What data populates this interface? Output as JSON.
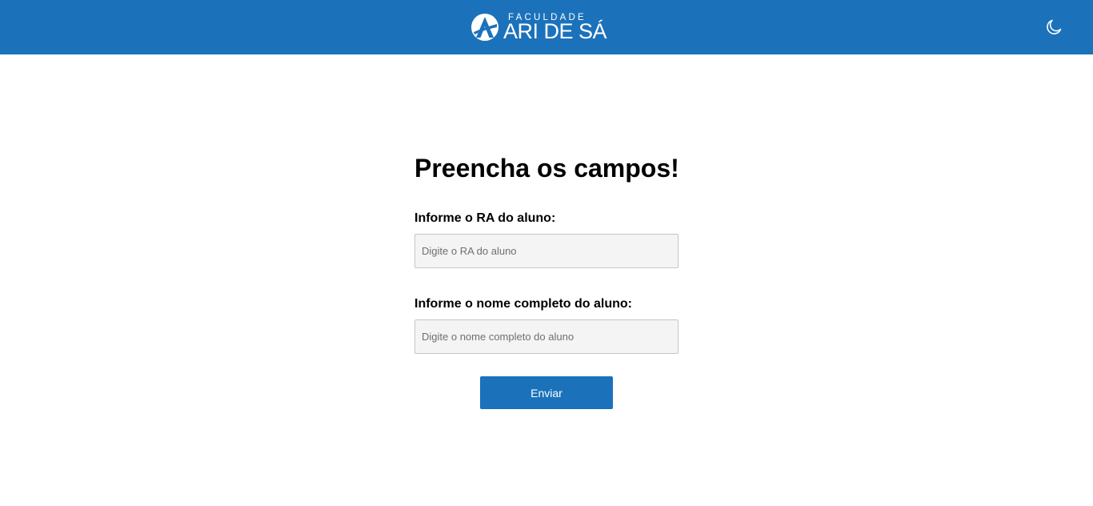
{
  "header": {
    "background_color": "#1b72bb",
    "logo": {
      "small_text": "FACULDADE",
      "big_text": "ARI DE SÁ"
    },
    "theme_toggle_icon": "moon-icon"
  },
  "form": {
    "title": "Preencha os campos!",
    "ra_label": "Informe o RA do aluno:",
    "ra_placeholder": "Digite o RA do aluno",
    "ra_value": "",
    "name_label": "Informe o nome completo do aluno:",
    "name_placeholder": "Digite o nome completo do aluno",
    "name_value": "",
    "submit_label": "Enviar",
    "accent_color": "#1b72bb"
  }
}
